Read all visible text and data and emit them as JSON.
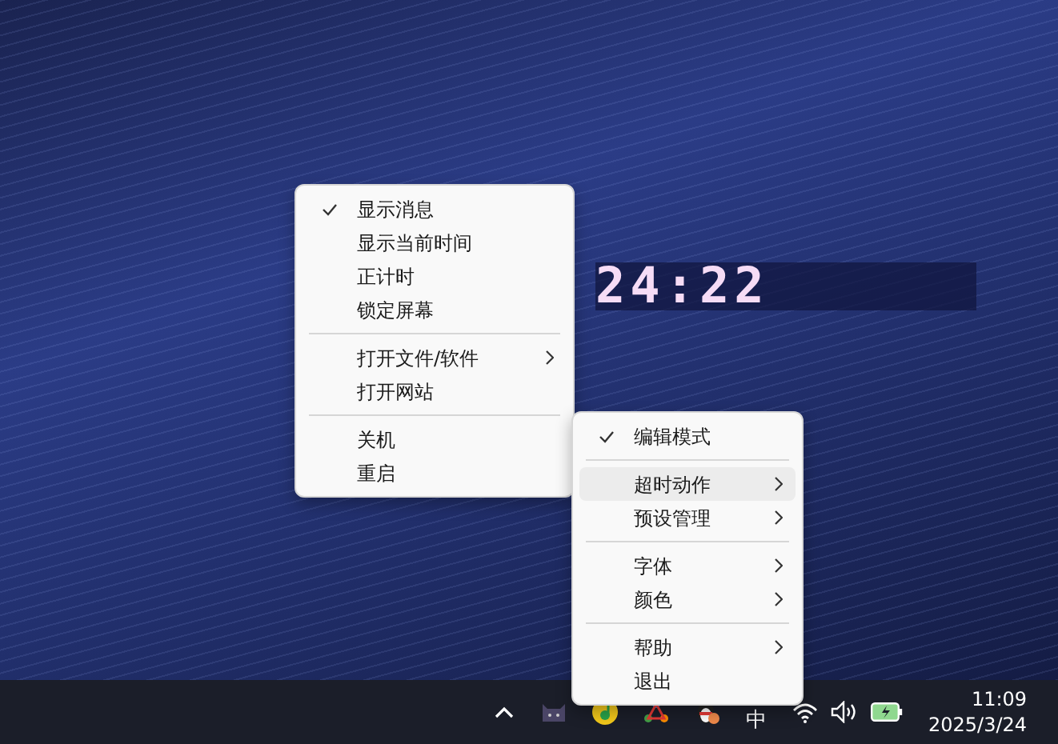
{
  "desktop": {
    "clock": "24:22"
  },
  "menus": [
    {
      "items": [
        {
          "kind": "item",
          "label": "显示消息",
          "checked": true,
          "submenu": false,
          "highlighted": false
        },
        {
          "kind": "item",
          "label": "显示当前时间",
          "checked": false,
          "submenu": false,
          "highlighted": false
        },
        {
          "kind": "item",
          "label": "正计时",
          "checked": false,
          "submenu": false,
          "highlighted": false
        },
        {
          "kind": "item",
          "label": "锁定屏幕",
          "checked": false,
          "submenu": false,
          "highlighted": false
        },
        {
          "kind": "separator"
        },
        {
          "kind": "item",
          "label": "打开文件/软件",
          "checked": false,
          "submenu": true,
          "highlighted": false
        },
        {
          "kind": "item",
          "label": "打开网站",
          "checked": false,
          "submenu": false,
          "highlighted": false
        },
        {
          "kind": "separator"
        },
        {
          "kind": "item",
          "label": "关机",
          "checked": false,
          "submenu": false,
          "highlighted": false
        },
        {
          "kind": "item",
          "label": "重启",
          "checked": false,
          "submenu": false,
          "highlighted": false
        }
      ]
    },
    {
      "items": [
        {
          "kind": "item",
          "label": "编辑模式",
          "checked": true,
          "submenu": false,
          "highlighted": false
        },
        {
          "kind": "separator"
        },
        {
          "kind": "item",
          "label": "超时动作",
          "checked": false,
          "submenu": true,
          "highlighted": true
        },
        {
          "kind": "item",
          "label": "预设管理",
          "checked": false,
          "submenu": true,
          "highlighted": false
        },
        {
          "kind": "separator"
        },
        {
          "kind": "item",
          "label": "字体",
          "checked": false,
          "submenu": true,
          "highlighted": false
        },
        {
          "kind": "item",
          "label": "颜色",
          "checked": false,
          "submenu": true,
          "highlighted": false
        },
        {
          "kind": "separator"
        },
        {
          "kind": "item",
          "label": "帮助",
          "checked": false,
          "submenu": true,
          "highlighted": false
        },
        {
          "kind": "item",
          "label": "退出",
          "checked": false,
          "submenu": false,
          "highlighted": false
        }
      ]
    }
  ],
  "taskbar": {
    "ime": "中",
    "time": "11:09",
    "date": "2025/3/24"
  }
}
